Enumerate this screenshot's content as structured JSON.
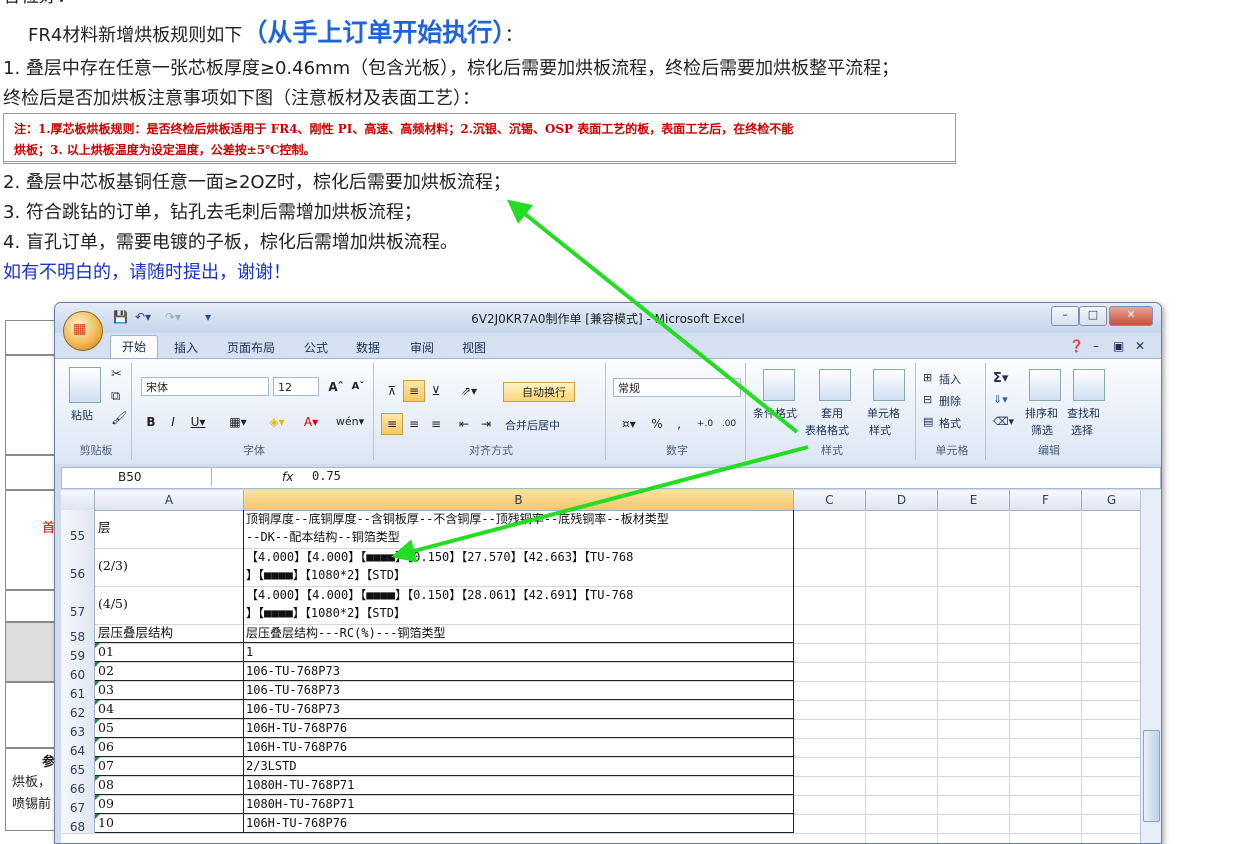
{
  "doc": {
    "greeting": "各位好：",
    "intro_prefix": "FR4材料新增烘板规则如下",
    "intro_highlight": "（从手上订单开始执行）",
    "intro_suffix": "：",
    "rule1": "1. 叠层中存在任意一张芯板厚度≥0.46mm（包含光板），棕化后需要加烘板流程，终检后需要加烘板整平流程；",
    "rule1_sub": "终检后是否加烘板注意事项如下图（注意板材及表面工艺）：",
    "note_line1": "注：1.厚芯板烘板规则：是否终检后烘板适用于 FR4、刚性 PI、高速、高频材料；2.沉银、沉锡、OSP 表面工艺的板，表面工艺后，在终检不能",
    "note_line2": "烘板；3. 以上烘板温度为设定温度，公差按±5℃控制。",
    "rule2": "2. 叠层中芯板基铜任意一面≥2OZ时，棕化后需要加烘板流程；",
    "rule3": "3. 符合跳钻的订单，钻孔去毛刺后需增加烘板流程；",
    "rule4": "4. 盲孔订单，需要电镀的子板，棕化后需增加烘板流程。",
    "closing": "如有不明白的，请随时提出，谢谢！"
  },
  "bg_table": {
    "cell_a": "首",
    "cell_b": "参",
    "cell_c": "烘板，",
    "cell_d": "喷锡前"
  },
  "excel": {
    "title": "6V2J0KR7A0制作单 [兼容模式] - Microsoft Excel",
    "tabs": [
      "开始",
      "插入",
      "页面布局",
      "公式",
      "数据",
      "审阅",
      "视图"
    ],
    "groups": {
      "clipboard": "剪贴板",
      "font": "字体",
      "align": "对齐方式",
      "number": "数字",
      "styles": "样式",
      "cells": "单元格",
      "edit": "编辑"
    },
    "paste": "粘贴",
    "font_name": "宋体",
    "font_size": "12",
    "wrap_text": "自动换行",
    "merge_center": "合并后居中",
    "number_format": "常规",
    "cond_format": "条件格式",
    "table_format_1": "套用",
    "table_format_2": "表格格式",
    "cell_style_1": "单元格",
    "cell_style_2": "样式",
    "insert": "插入",
    "delete": "删除",
    "format": "格式",
    "sort_filter_1": "排序和",
    "sort_filter_2": "筛选",
    "find_select_1": "查找和",
    "find_select_2": "选择",
    "name_box": "B50",
    "formula_value": "0.75",
    "columns": [
      "A",
      "B",
      "C",
      "D",
      "E",
      "F",
      "G"
    ],
    "rows": [
      {
        "n": "55",
        "a": "层",
        "b": "顶铜厚度--底铜厚度--含铜板厚--不含铜厚--顶残铜率--底残铜率--板材类型\n--DK--配本结构--铜箔类型"
      },
      {
        "n": "56",
        "a": "(2/3)",
        "b": "【4.000】【4.000】【■■■■】【0.150】【27.570】【42.663】【TU-768\n】【■■■■】【1080*2】【STD】"
      },
      {
        "n": "57",
        "a": "(4/5)",
        "b": "【4.000】【4.000】【■■■■】【0.150】【28.061】【42.691】【TU-768\n】【■■■■】【1080*2】【STD】"
      },
      {
        "n": "58",
        "a": "层压叠层结构",
        "b": "层压叠层结构---RC(%)---铜箔类型"
      },
      {
        "n": "59",
        "a": "01",
        "b": "1"
      },
      {
        "n": "60",
        "a": "02",
        "b": "106-TU-768P73"
      },
      {
        "n": "61",
        "a": "03",
        "b": "106-TU-768P73"
      },
      {
        "n": "62",
        "a": "04",
        "b": "106-TU-768P73"
      },
      {
        "n": "63",
        "a": "05",
        "b": "106H-TU-768P76"
      },
      {
        "n": "64",
        "a": "06",
        "b": "106H-TU-768P76"
      },
      {
        "n": "65",
        "a": "07",
        "b": "2/3LSTD"
      },
      {
        "n": "66",
        "a": "08",
        "b": "1080H-TU-768P71"
      },
      {
        "n": "67",
        "a": "09",
        "b": "1080H-TU-768P71"
      },
      {
        "n": "68",
        "a": "10",
        "b": "106H-TU-768P76"
      }
    ]
  },
  "colors": {
    "arrow": "#22dd22",
    "highlight": "#1f64d8",
    "note_red": "#cc0000",
    "closing_blue": "#1a33cc"
  }
}
